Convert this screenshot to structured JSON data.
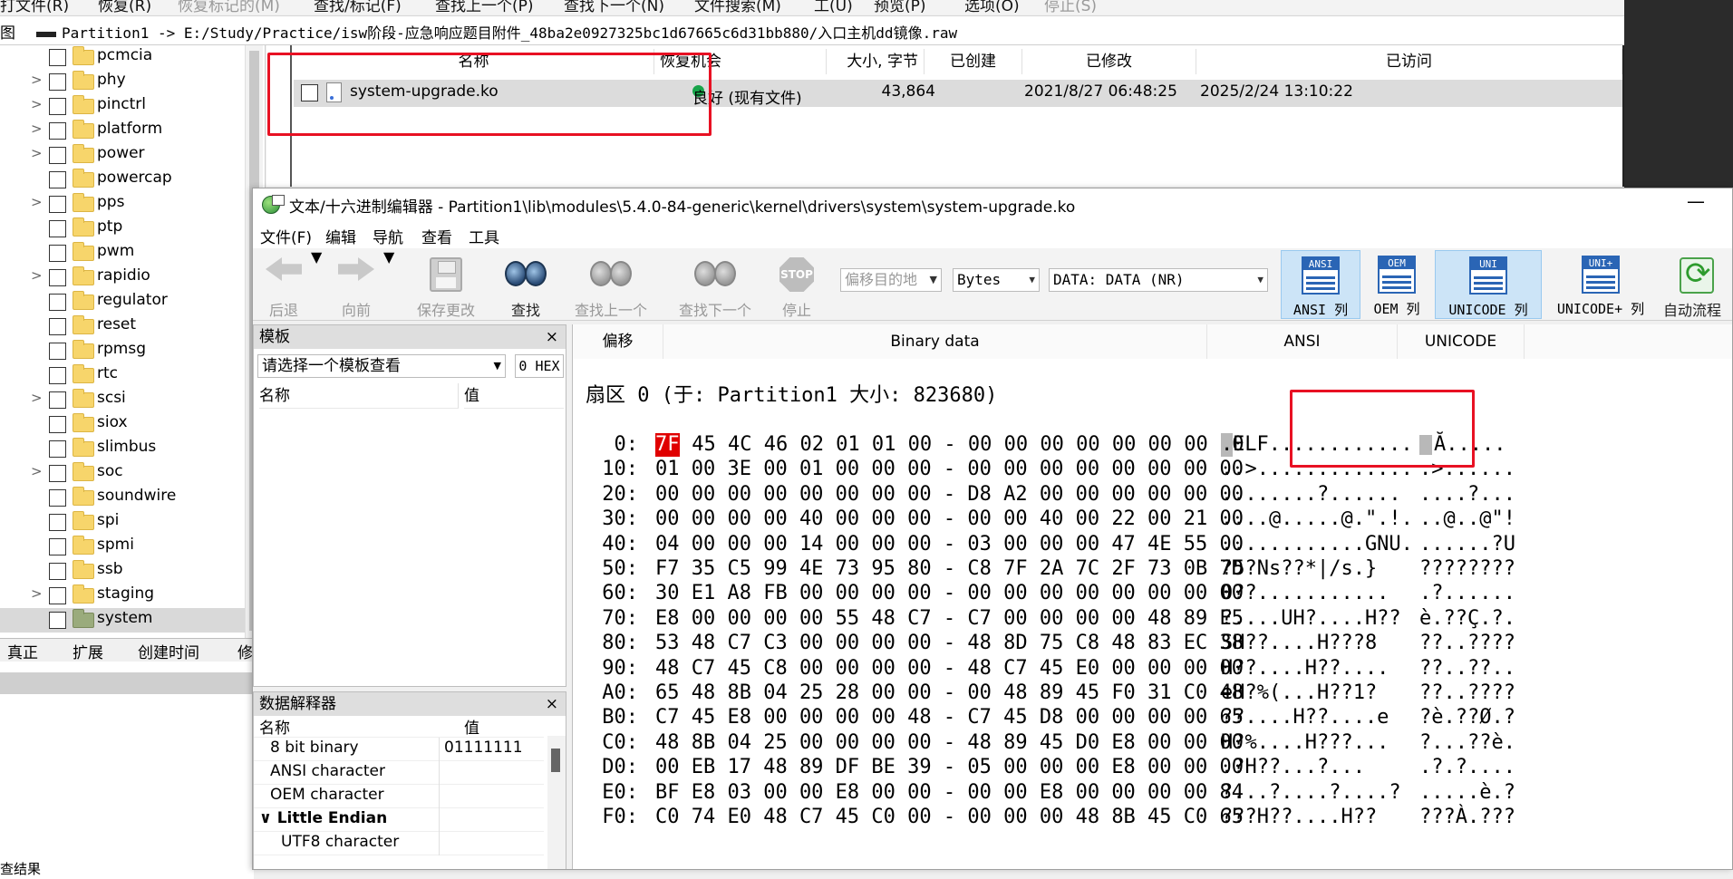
{
  "top_menu": {
    "items": [
      {
        "label": "打文件(R)",
        "enabled": true
      },
      {
        "label": "恢复(R)",
        "enabled": true
      },
      {
        "label": "恢复标记的(M)",
        "enabled": false
      },
      {
        "label": "查找/标记(F)",
        "enabled": true
      },
      {
        "label": "查找上一个(P)",
        "enabled": true
      },
      {
        "label": "查找下一个(N)",
        "enabled": true
      },
      {
        "label": "文件搜索(M)",
        "enabled": true
      },
      {
        "label": "工(U)",
        "enabled": true
      },
      {
        "label": "预览(P)",
        "enabled": true
      },
      {
        "label": "选项(O)",
        "enabled": true
      },
      {
        "label": "停止(S)",
        "enabled": false
      }
    ]
  },
  "path_bar": {
    "label": "图",
    "path": "Partition1 -> E:/Study/Practice/isw阶段-应急响应题目附件_48ba2e0927325bc1d67665c6d31bb880/入口主机dd镜像.raw"
  },
  "tree": {
    "items": [
      {
        "name": "pcmcia",
        "expandable": false
      },
      {
        "name": "phy",
        "expandable": true
      },
      {
        "name": "pinctrl",
        "expandable": true
      },
      {
        "name": "platform",
        "expandable": true
      },
      {
        "name": "power",
        "expandable": true
      },
      {
        "name": "powercap",
        "expandable": false
      },
      {
        "name": "pps",
        "expandable": true
      },
      {
        "name": "ptp",
        "expandable": false
      },
      {
        "name": "pwm",
        "expandable": false
      },
      {
        "name": "rapidio",
        "expandable": true
      },
      {
        "name": "regulator",
        "expandable": false
      },
      {
        "name": "reset",
        "expandable": false
      },
      {
        "name": "rpmsg",
        "expandable": false
      },
      {
        "name": "rtc",
        "expandable": false
      },
      {
        "name": "scsi",
        "expandable": true
      },
      {
        "name": "siox",
        "expandable": false
      },
      {
        "name": "slimbus",
        "expandable": false
      },
      {
        "name": "soc",
        "expandable": true
      },
      {
        "name": "soundwire",
        "expandable": false
      },
      {
        "name": "spi",
        "expandable": false
      },
      {
        "name": "spmi",
        "expandable": false
      },
      {
        "name": "ssb",
        "expandable": false
      },
      {
        "name": "staging",
        "expandable": true
      },
      {
        "name": "system",
        "expandable": false,
        "selected": true
      }
    ]
  },
  "bottom_tabs": [
    "真正",
    "扩展",
    "创建时间",
    "修"
  ],
  "bottom_status": "查结果",
  "file_list": {
    "columns": [
      "名称",
      "恢复机会",
      "大小, 字节",
      "已创建",
      "已修改",
      "已访问"
    ],
    "rows": [
      {
        "name": "system-upgrade.ko",
        "recovery": "良好 (现有文件)",
        "size": "43,864",
        "created": "",
        "modified": "2021/8/27 06:48:25",
        "accessed": "2025/2/24 13:10:22"
      }
    ]
  },
  "editor": {
    "title": "文本/十六进制编辑器 - Partition1\\lib\\modules\\5.4.0-84-generic\\kernel\\drivers\\system\\system-upgrade.ko",
    "minimize_glyph": "—",
    "menu": [
      "文件(F)",
      "编辑",
      "导航",
      "查看",
      "工具"
    ],
    "toolbar": {
      "back": "后退",
      "forward": "向前",
      "save": "保存更改",
      "find": "查找",
      "find_prev": "查找上一个",
      "find_next": "查找下一个",
      "stop": "停止",
      "stop_sign": "STOP",
      "offset_placeholder": "偏移目的地",
      "unit_select": "Bytes",
      "data_select": "DATA: DATA (NR)",
      "col_ansi": {
        "icon": "ANSI",
        "label": "ANSI 列",
        "active": true
      },
      "col_oem": {
        "icon": "OEM",
        "label": "OEM 列",
        "active": false
      },
      "col_unicode": {
        "icon": "UNI",
        "label": "UNICODE 列",
        "active": true
      },
      "col_unicode_plus": {
        "icon": "UNI+",
        "label": "UNICODE+ 列",
        "active": false
      },
      "auto_flow": "自动流程"
    },
    "template_panel": {
      "title": "模板",
      "close": "×",
      "select_placeholder": "请选择一个模板查看",
      "hex_button": "0 HEX",
      "col_name": "名称",
      "col_value": "值"
    },
    "interpreter": {
      "title": "数据解释器",
      "close": "×",
      "col_name": "名称",
      "col_value": "值",
      "rows": [
        {
          "name": "8 bit binary",
          "value": "01111111",
          "indent": 1,
          "bold": false
        },
        {
          "name": "ANSI character",
          "value": "",
          "indent": 1,
          "bold": false
        },
        {
          "name": "OEM character",
          "value": "",
          "indent": 1,
          "bold": false
        },
        {
          "name": "∨ Little Endian",
          "value": "",
          "indent": 0,
          "bold": true
        },
        {
          "name": "UTF8 character",
          "value": "",
          "indent": 2,
          "bold": false
        }
      ]
    },
    "hex_view": {
      "columns": [
        "偏移",
        "Binary data",
        "ANSI",
        "UNICODE"
      ],
      "sector_line": "扇区 0 (于: Partition1 大小: 823680)",
      "rows": [
        {
          "offset": "0:",
          "first": "7F",
          "rest": " 45 4C 46 02 01 01 00 - 00 00 00 00 00 00 00 00",
          "ansi_first": ".",
          "ansi_rest": "ELF............",
          "uni_first": "",
          "uni_rest": "Ă....."
        },
        {
          "offset": "10:",
          "hex": "01 00 3E 00 01 00 00 00 - 00 00 00 00 00 00 00 00",
          "ansi": "..>.............",
          "uni": ".>......"
        },
        {
          "offset": "20:",
          "hex": "00 00 00 00 00 00 00 00 - D8 A2 00 00 00 00 00 00",
          "ansi": "........?......",
          "uni": "....?..."
        },
        {
          "offset": "30:",
          "hex": "00 00 00 00 40 00 00 00 - 00 00 40 00 22 00 21 00",
          "ansi": "....@.....@.\".!.",
          "uni": "..@..@\"!"
        },
        {
          "offset": "40:",
          "hex": "04 00 00 00 14 00 00 00 - 03 00 00 00 47 4E 55 00",
          "ansi": "............GNU.",
          "uni": "......?U"
        },
        {
          "offset": "50:",
          "hex": "F7 35 C5 99 4E 73 95 80 - C8 7F 2A 7C 2F 73 0B 7D",
          "ansi": "?5?Ns??*|/s.}",
          "uni": "????????"
        },
        {
          "offset": "60:",
          "hex": "30 E1 A8 FB 00 00 00 00 - 00 00 00 00 00 00 00 00",
          "ansi": "0??...........",
          "uni": ".?......"
        },
        {
          "offset": "70:",
          "hex": "E8 00 00 00 00 55 48 C7 - C7 00 00 00 00 48 89 E5",
          "ansi": "?....UH?....H??",
          "uni": "è.??Ç.?."
        },
        {
          "offset": "80:",
          "hex": "53 48 C7 C3 00 00 00 00 - 48 8D 75 C8 48 83 EC 38",
          "ansi": "SH??....H???8",
          "uni": "??..????"
        },
        {
          "offset": "90:",
          "hex": "48 C7 45 C8 00 00 00 00 - 48 C7 45 E0 00 00 00 00",
          "ansi": "H??....H??....",
          "uni": "??..??.."
        },
        {
          "offset": "A0:",
          "hex": "65 48 8B 04 25 28 00 00 - 00 48 89 45 F0 31 C0 48",
          "ansi": "eH?%(...H??1?",
          "uni": "??..????"
        },
        {
          "offset": "B0:",
          "hex": "C7 45 E8 00 00 00 00 48 - C7 45 D8 00 00 00 00 65",
          "ansi": "??....H??....e",
          "uni": "?è.??Ø.?"
        },
        {
          "offset": "C0:",
          "hex": "48 8B 04 25 00 00 00 00 - 48 89 45 D0 E8 00 00 00",
          "ansi": "H?%....H???...",
          "uni": "?...??è."
        },
        {
          "offset": "D0:",
          "hex": "00 EB 17 48 89 DF BE 39 - 05 00 00 00 E8 00 00 00",
          "ansi": ".?H??...?...",
          "uni": ".?.?...."
        },
        {
          "offset": "E0:",
          "hex": "BF E8 03 00 00 E8 00 00 - 00 00 E8 00 00 00 00 84",
          "ansi": "?...?....?....?",
          "uni": ".....è.?"
        },
        {
          "offset": "F0:",
          "hex": "C0 74 E0 48 C7 45 C0 00 - 00 00 00 48 8B 45 C0 65",
          "ansi": "???H??....H??",
          "uni": "???À.???"
        }
      ]
    }
  },
  "colors": {
    "annotation_red": "#e81123",
    "status_green": "#17a44a",
    "highlight_red": "#e00000",
    "active_button": "#cce4f7"
  }
}
